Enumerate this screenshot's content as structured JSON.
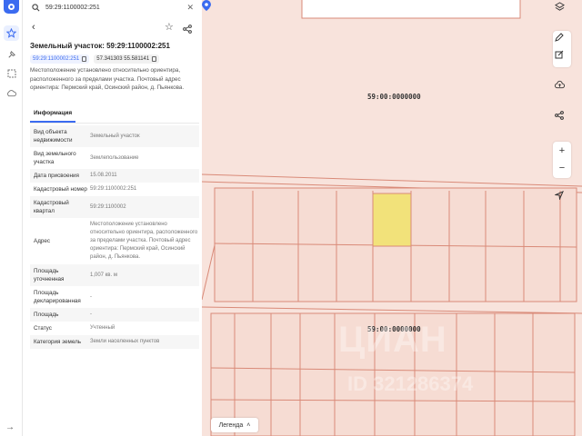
{
  "search": {
    "value": "59:29:1100002:251"
  },
  "parcel": {
    "title": "Земельный участок: 59:29:1100002:251",
    "cadastral_chip": "59:29:1100002:251",
    "coords_chip": "57.341303 55.581141",
    "location_text": "Местоположение установлено относительно ориентира, расположенного за пределами участка. Почтовый адрес ориентира: Пермский край, Осинский район, д. Пьянкова."
  },
  "tabs": {
    "info": "Информация"
  },
  "info_rows": [
    {
      "key": "Вид объекта недвижимости",
      "value": "Земельный участок"
    },
    {
      "key": "Вид земельного участка",
      "value": "Землепользование"
    },
    {
      "key": "Дата присвоения",
      "value": "15.08.2011"
    },
    {
      "key": "Кадастровый номер",
      "value": "59:29:1100002:251"
    },
    {
      "key": "Кадастровый квартал",
      "value": "59:29:1100002"
    },
    {
      "key": "Адрес",
      "value": "Местоположение установлено относительно ориентира, расположенного за пределами участка. Почтовый адрес ориентира: Пермский край, Осинский район, д. Пьянкова."
    },
    {
      "key": "Площадь уточненная",
      "value": "1,007 кв. м"
    },
    {
      "key": "Площадь декларированная",
      "value": "-"
    },
    {
      "key": "Площадь",
      "value": "-"
    },
    {
      "key": "Статус",
      "value": "Учтенный"
    },
    {
      "key": "Категория земель",
      "value": "Земли населенных пунктов"
    }
  ],
  "map": {
    "label_top": "59:00:0000000",
    "label_bottom": "59:00:0000000",
    "watermark": "ЦИАН",
    "watermark_id": "ID 321286374",
    "legend": "Легенда",
    "colors": {
      "background": "#f8e3dc",
      "parcel_line": "#d98a78",
      "selected": "#f2e27a",
      "accent": "#3b6bf0"
    }
  },
  "icons": [
    "search-icon",
    "close-icon",
    "back-icon",
    "star-icon",
    "share-icon",
    "copy-icon",
    "layers-icon",
    "pencil-icon",
    "edit-icon",
    "upload-icon",
    "zoom-in-icon",
    "zoom-out-icon",
    "locate-icon"
  ]
}
